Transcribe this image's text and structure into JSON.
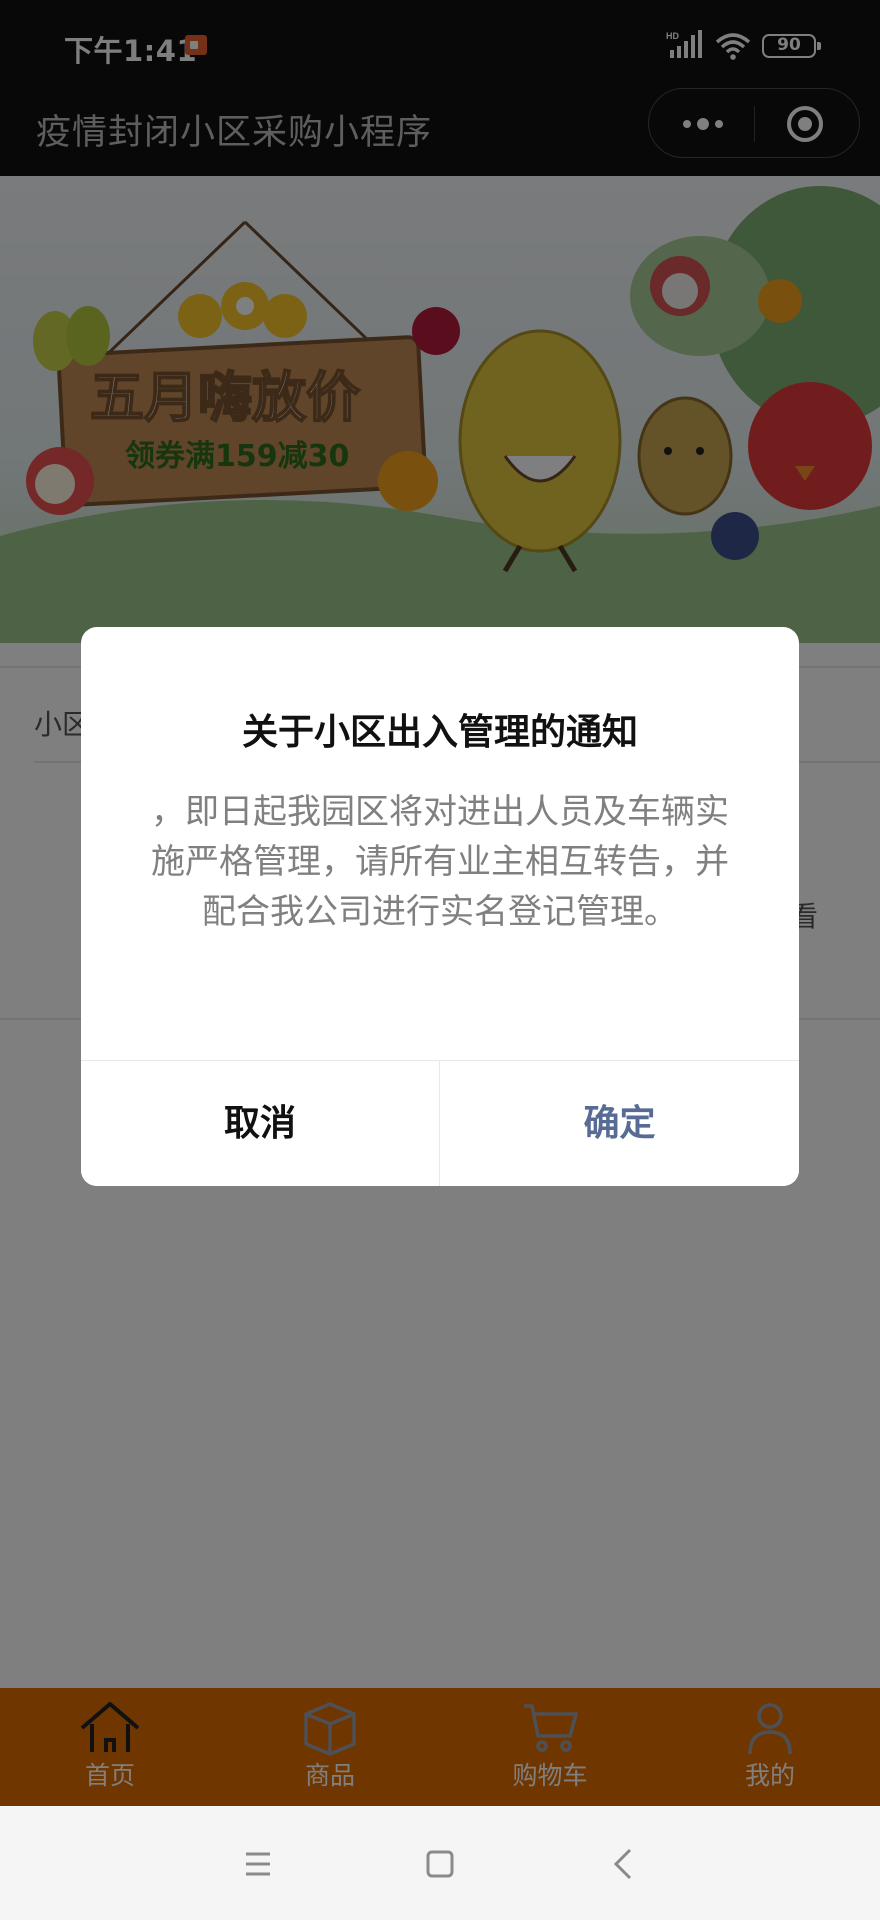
{
  "status_bar": {
    "time": "下午1:41",
    "battery": "90",
    "network_label": "HD"
  },
  "nav": {
    "title": "疫情封闭小区采购小程序"
  },
  "banner": {
    "headline": "五月嗨放价",
    "subline": "领券满159减30"
  },
  "page": {
    "community_label": "小区",
    "right_fragment": "看"
  },
  "modal": {
    "title": "关于小区出入管理的通知",
    "content": "，即日起我园区将对进出人员及车辆实施严格管理，请所有业主相互转告，并配合我公司进行实名登记管理。",
    "cancel_label": "取消",
    "confirm_label": "确定",
    "confirm_color": "#576b95"
  },
  "tab_bar": {
    "color": "#e06c00",
    "items": [
      {
        "label": "首页",
        "icon": "home-icon"
      },
      {
        "label": "商品",
        "icon": "box-icon"
      },
      {
        "label": "购物车",
        "icon": "cart-icon"
      },
      {
        "label": "我的",
        "icon": "user-icon"
      }
    ]
  },
  "system_nav": {
    "buttons": [
      "menu-icon",
      "home-square-icon",
      "back-icon"
    ]
  }
}
